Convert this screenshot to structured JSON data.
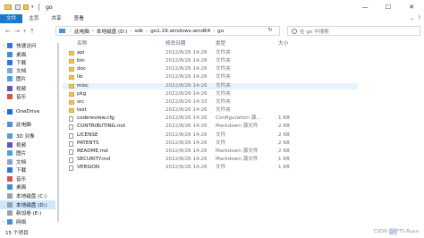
{
  "window": {
    "title": "go",
    "minimize": "—",
    "maximize": "☐",
    "close": "✕"
  },
  "ribbon": {
    "tabs": [
      "文件",
      "主页",
      "共享",
      "查看"
    ],
    "help": "?"
  },
  "address": {
    "crumbs": [
      "此电脑",
      "本地磁盘 (D:)",
      "sdk",
      "go1.19.windows-amd64",
      "go"
    ],
    "refresh": "↻",
    "search_placeholder": "在 go 中搜索"
  },
  "nav": {
    "items": [
      {
        "label": "快速访问",
        "icon": "star-icon",
        "indent": 0
      },
      {
        "label": "桌面",
        "icon": "desktop-icon",
        "indent": 1
      },
      {
        "label": "下载",
        "icon": "download-icon",
        "indent": 1
      },
      {
        "label": "文档",
        "icon": "document-icon",
        "indent": 1
      },
      {
        "label": "图片",
        "icon": "picture-icon",
        "indent": 1
      },
      {
        "label": "视频",
        "icon": "video-icon",
        "indent": 1
      },
      {
        "label": "音乐",
        "icon": "music-icon",
        "indent": 1
      },
      {
        "label": "OneDrive",
        "icon": "cloud-icon",
        "indent": 0
      },
      {
        "label": "此电脑",
        "icon": "pc-icon",
        "indent": 0
      },
      {
        "label": "3D 对象",
        "icon": "cube-icon",
        "indent": 1
      },
      {
        "label": "视频",
        "icon": "video-icon",
        "indent": 1
      },
      {
        "label": "图片",
        "icon": "picture-icon",
        "indent": 1
      },
      {
        "label": "文档",
        "icon": "document-icon",
        "indent": 1
      },
      {
        "label": "下载",
        "icon": "download-icon",
        "indent": 1
      },
      {
        "label": "音乐",
        "icon": "music-icon",
        "indent": 1
      },
      {
        "label": "桌面",
        "icon": "desktop-icon",
        "indent": 1
      },
      {
        "label": "本地磁盘 (C:)",
        "icon": "drive-icon",
        "indent": 1
      },
      {
        "label": "本地磁盘 (D:)",
        "icon": "drive-icon",
        "indent": 1,
        "selected": true
      },
      {
        "label": "新加卷 (E:)",
        "icon": "drive-icon",
        "indent": 1
      },
      {
        "label": "网络",
        "icon": "network-icon",
        "indent": 0
      }
    ]
  },
  "columns": {
    "name": "名称",
    "date": "修改日期",
    "type": "类型",
    "size": "大小"
  },
  "files": [
    {
      "name": "api",
      "date": "2022/8/26 14:26",
      "type": "文件夹",
      "size": "",
      "kind": "folder"
    },
    {
      "name": "bin",
      "date": "2022/8/26 14:26",
      "type": "文件夹",
      "size": "",
      "kind": "folder"
    },
    {
      "name": "doc",
      "date": "2022/8/26 14:26",
      "type": "文件夹",
      "size": "",
      "kind": "folder"
    },
    {
      "name": "lib",
      "date": "2022/8/26 14:26",
      "type": "文件夹",
      "size": "",
      "kind": "folder"
    },
    {
      "name": "misc",
      "date": "2022/8/26 14:26",
      "type": "文件夹",
      "size": "",
      "kind": "folder",
      "hover": true
    },
    {
      "name": "pkg",
      "date": "2022/8/26 14:26",
      "type": "文件夹",
      "size": "",
      "kind": "folder"
    },
    {
      "name": "src",
      "date": "2022/8/26 14:33",
      "type": "文件夹",
      "size": "",
      "kind": "folder"
    },
    {
      "name": "test",
      "date": "2022/8/26 14:26",
      "type": "文件夹",
      "size": "",
      "kind": "folder"
    },
    {
      "name": "codereview.cfg",
      "date": "2022/8/26 14:26",
      "type": "Configuration 源...",
      "size": "1 KB",
      "kind": "file"
    },
    {
      "name": "CONTRIBUTING.md",
      "date": "2022/8/26 14:26",
      "type": "Markdown 源文件",
      "size": "2 KB",
      "kind": "file"
    },
    {
      "name": "LICENSE",
      "date": "2022/8/26 14:26",
      "type": "文件",
      "size": "2 KB",
      "kind": "file"
    },
    {
      "name": "PATENTS",
      "date": "2022/8/26 14:26",
      "type": "文件",
      "size": "2 KB",
      "kind": "file"
    },
    {
      "name": "README.md",
      "date": "2022/8/26 14:26",
      "type": "Markdown 源文件",
      "size": "2 KB",
      "kind": "file"
    },
    {
      "name": "SECURITY.md",
      "date": "2022/8/26 14:26",
      "type": "Markdown 源文件",
      "size": "1 KB",
      "kind": "file"
    },
    {
      "name": "VERSION",
      "date": "2022/8/26 14:26",
      "type": "文件",
      "size": "1 KB",
      "kind": "file"
    }
  ],
  "status": {
    "count": "15 个项目",
    "watermark": "CSDN @LYTS-Ruan"
  },
  "colors": {
    "accent": "#1979ca",
    "folder": "#f0c75e",
    "selected": "#cce8ff",
    "hover": "#e5f3ff"
  }
}
